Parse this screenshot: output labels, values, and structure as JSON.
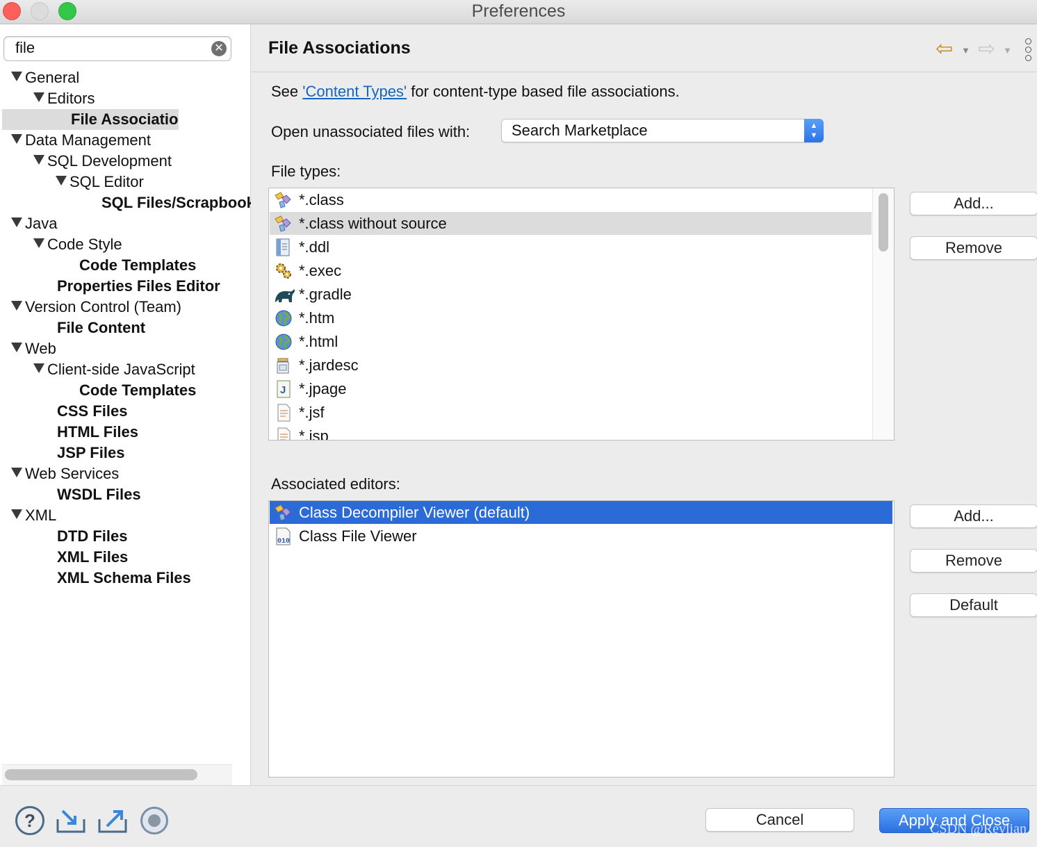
{
  "window": {
    "title": "Preferences",
    "colors": {
      "close": "#fc605b",
      "minimize": "#dcdcdc",
      "maximize": "#34c84a"
    }
  },
  "filter": {
    "value": "file"
  },
  "tree": [
    {
      "label": "General",
      "level": 0,
      "expanded": true,
      "bold": false
    },
    {
      "label": "Editors",
      "level": 1,
      "expanded": true,
      "bold": false
    },
    {
      "label": "File Associations",
      "level": 2,
      "expanded": false,
      "bold": true,
      "selected": true
    },
    {
      "label": "Data Management",
      "level": 0,
      "expanded": true,
      "bold": false
    },
    {
      "label": "SQL Development",
      "level": 1,
      "expanded": true,
      "bold": false
    },
    {
      "label": "SQL Editor",
      "level": 2,
      "expanded": true,
      "bold": false
    },
    {
      "label": "SQL Files/Scrapbook",
      "level": 3,
      "expanded": false,
      "bold": true
    },
    {
      "label": "Java",
      "level": 0,
      "expanded": true,
      "bold": false
    },
    {
      "label": "Code Style",
      "level": 1,
      "expanded": true,
      "bold": false
    },
    {
      "label": "Code Templates",
      "level": 2,
      "expanded": false,
      "bold": true
    },
    {
      "label": "Properties Files Editor",
      "level": 1,
      "expanded": false,
      "bold": true
    },
    {
      "label": "Version Control (Team)",
      "level": 0,
      "expanded": true,
      "bold": false
    },
    {
      "label": "File Content",
      "level": 1,
      "expanded": false,
      "bold": true
    },
    {
      "label": "Web",
      "level": 0,
      "expanded": true,
      "bold": false
    },
    {
      "label": "Client-side JavaScript",
      "level": 1,
      "expanded": true,
      "bold": false
    },
    {
      "label": "Code Templates",
      "level": 2,
      "expanded": false,
      "bold": true
    },
    {
      "label": "CSS Files",
      "level": 1,
      "expanded": false,
      "bold": true
    },
    {
      "label": "HTML Files",
      "level": 1,
      "expanded": false,
      "bold": true
    },
    {
      "label": "JSP Files",
      "level": 1,
      "expanded": false,
      "bold": true
    },
    {
      "label": "Web Services",
      "level": 0,
      "expanded": true,
      "bold": false
    },
    {
      "label": "WSDL Files",
      "level": 1,
      "expanded": false,
      "bold": true
    },
    {
      "label": "XML",
      "level": 0,
      "expanded": true,
      "bold": false
    },
    {
      "label": "DTD Files",
      "level": 1,
      "expanded": false,
      "bold": true
    },
    {
      "label": "XML Files",
      "level": 1,
      "expanded": false,
      "bold": true
    },
    {
      "label": "XML Schema Files",
      "level": 1,
      "expanded": false,
      "bold": true
    }
  ],
  "page": {
    "title": "File Associations",
    "see_prefix": "See ",
    "content_types_link": "'Content Types'",
    "see_suffix": " for content-type based file associations.",
    "open_label": "Open unassociated files with:",
    "open_value": "Search Marketplace",
    "file_types_label": "File types:",
    "associated_editors_label": "Associated editors:"
  },
  "file_types": [
    {
      "label": "*.class",
      "icon": "class-decompiler-icon"
    },
    {
      "label": "*.class without source",
      "icon": "class-decompiler-icon",
      "highlighted": true
    },
    {
      "label": "*.ddl",
      "icon": "sql-file-icon"
    },
    {
      "label": "*.exec",
      "icon": "gears-icon"
    },
    {
      "label": "*.gradle",
      "icon": "gradle-elephant-icon"
    },
    {
      "label": "*.htm",
      "icon": "globe-icon"
    },
    {
      "label": "*.html",
      "icon": "globe-icon"
    },
    {
      "label": "*.jardesc",
      "icon": "jar-icon"
    },
    {
      "label": "*.jpage",
      "icon": "java-page-icon"
    },
    {
      "label": "*.jsf",
      "icon": "text-file-icon"
    },
    {
      "label": "*.jsp",
      "icon": "text-file-icon"
    }
  ],
  "associated_editors": [
    {
      "label": "Class Decompiler Viewer (default)",
      "icon": "class-decompiler-icon",
      "selected": true
    },
    {
      "label": "Class File Viewer",
      "icon": "binary-file-icon"
    }
  ],
  "buttons": {
    "ft_add": "Add...",
    "ft_remove": "Remove",
    "ae_add": "Add...",
    "ae_remove": "Remove",
    "ae_default": "Default",
    "cancel": "Cancel",
    "apply_close": "Apply and Close"
  },
  "watermark": "CSDN @Reylian",
  "accent": "#2a6bd8",
  "link_color": "#1565c0"
}
